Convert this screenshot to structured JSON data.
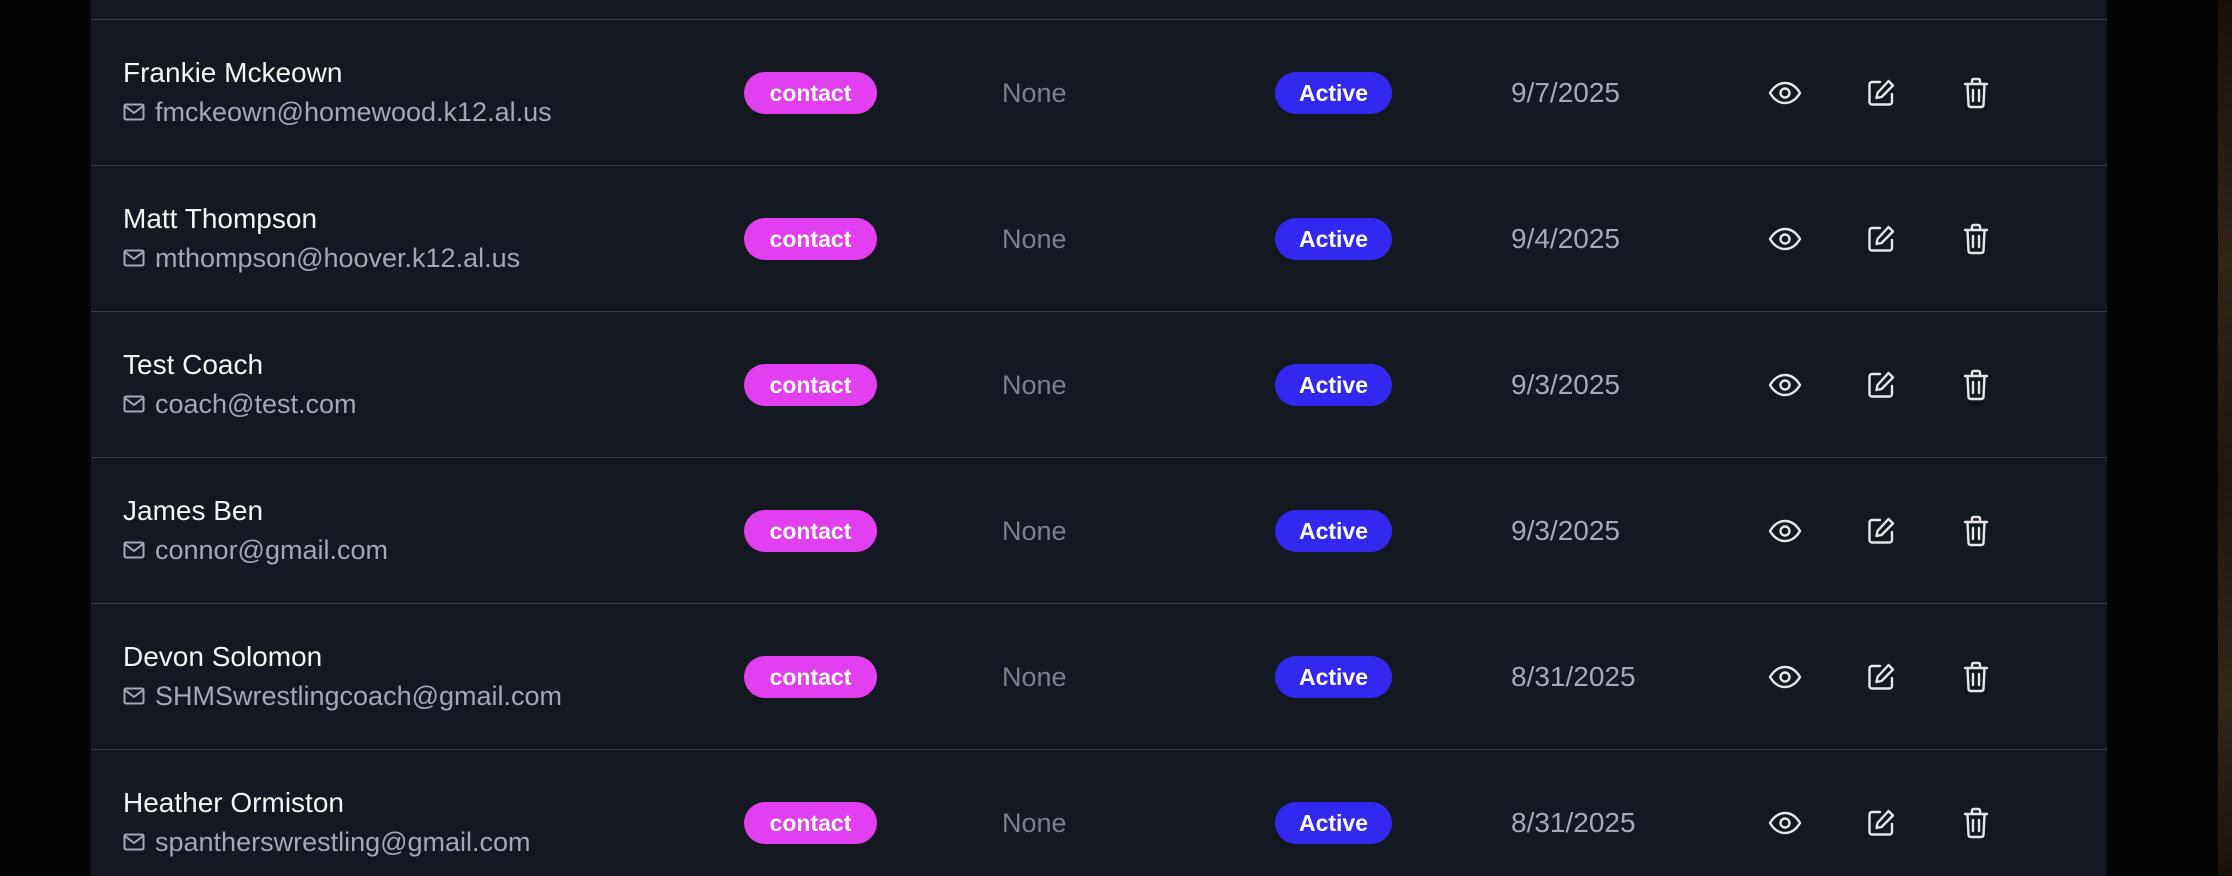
{
  "colors": {
    "contact_badge": "#e23ff0",
    "active_badge": "#3328f0",
    "row_background": "#141820",
    "divider": "#343b47"
  },
  "icons": {
    "email": "mail-icon",
    "view": "eye-icon",
    "edit": "edit-icon",
    "delete": "trash-icon"
  },
  "rows": [
    {
      "name": "Frankie Mckeown",
      "email": "fmckeown@homewood.k12.al.us",
      "type": "contact",
      "team": "None",
      "status": "Active",
      "date": "9/7/2025"
    },
    {
      "name": "Matt Thompson",
      "email": "mthompson@hoover.k12.al.us",
      "type": "contact",
      "team": "None",
      "status": "Active",
      "date": "9/4/2025"
    },
    {
      "name": "Test Coach",
      "email": "coach@test.com",
      "type": "contact",
      "team": "None",
      "status": "Active",
      "date": "9/3/2025"
    },
    {
      "name": "James Ben",
      "email": "connor@gmail.com",
      "type": "contact",
      "team": "None",
      "status": "Active",
      "date": "9/3/2025"
    },
    {
      "name": "Devon Solomon",
      "email": "SHMSwrestlingcoach@gmail.com",
      "type": "contact",
      "team": "None",
      "status": "Active",
      "date": "8/31/2025"
    },
    {
      "name": "Heather Ormiston",
      "email": "spantherswrestling@gmail.com",
      "type": "contact",
      "team": "None",
      "status": "Active",
      "date": "8/31/2025"
    }
  ]
}
